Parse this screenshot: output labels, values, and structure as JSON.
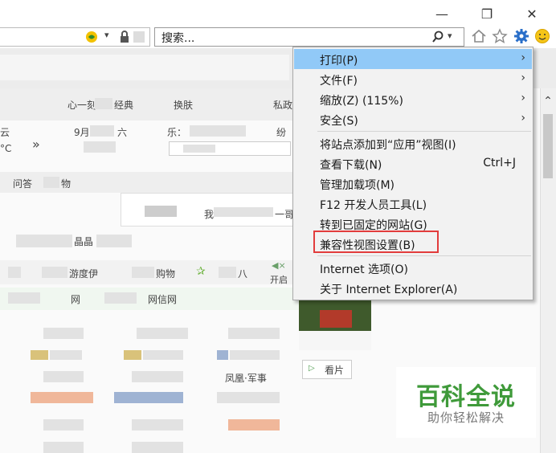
{
  "window": {
    "minimize": "—",
    "restore": "❐",
    "close": "✕"
  },
  "search": {
    "placeholder": "搜索..."
  },
  "menu": {
    "items": [
      {
        "label": "打印(P)",
        "arrow": "›"
      },
      {
        "label": "文件(F)",
        "arrow": "›"
      },
      {
        "label": "缩放(Z) (115%)",
        "arrow": "›"
      },
      {
        "label": "安全(S)",
        "arrow": "›"
      },
      {
        "label": "将站点添加到“应用”视图(I)"
      },
      {
        "label": "查看下载(N)",
        "shortcut": "Ctrl+J"
      },
      {
        "label": "管理加载项(M)"
      },
      {
        "label": "F12 开发人员工具(L)"
      },
      {
        "label": "转到已固定的网站(G)"
      },
      {
        "label": "兼容性视图设置(B)"
      },
      {
        "label": "Internet 选项(O)"
      },
      {
        "label": "关于 Internet Explorer(A)"
      }
    ]
  },
  "page": {
    "t1": "心一刻",
    "t2": "经典",
    "t3": "换肤",
    "t4": "私政",
    "t5": "云",
    "t6": "°C",
    "t7": "»",
    "t8": "9月",
    "t9": "六",
    "t10": "乐：",
    "t11": "纷",
    "t12": "问答",
    "t13": "物",
    "t14": "晶晶",
    "t15": "游度伊",
    "t16": "购物",
    "t17": "八",
    "t18": "开启",
    "t19": "网",
    "t20": "网信网",
    "t21": "凤凰·军事",
    "t22": "看片",
    "t23": "一哥",
    "t24": "我"
  },
  "watermark": {
    "title": "百科全说",
    "subtitle": "助你轻松解决"
  },
  "colors": {
    "menu_highlight": "#91c9f7",
    "red_outline": "#e23c3c",
    "watermark_green": "#3f9a3a",
    "gear_blue": "#2a6fc9"
  }
}
